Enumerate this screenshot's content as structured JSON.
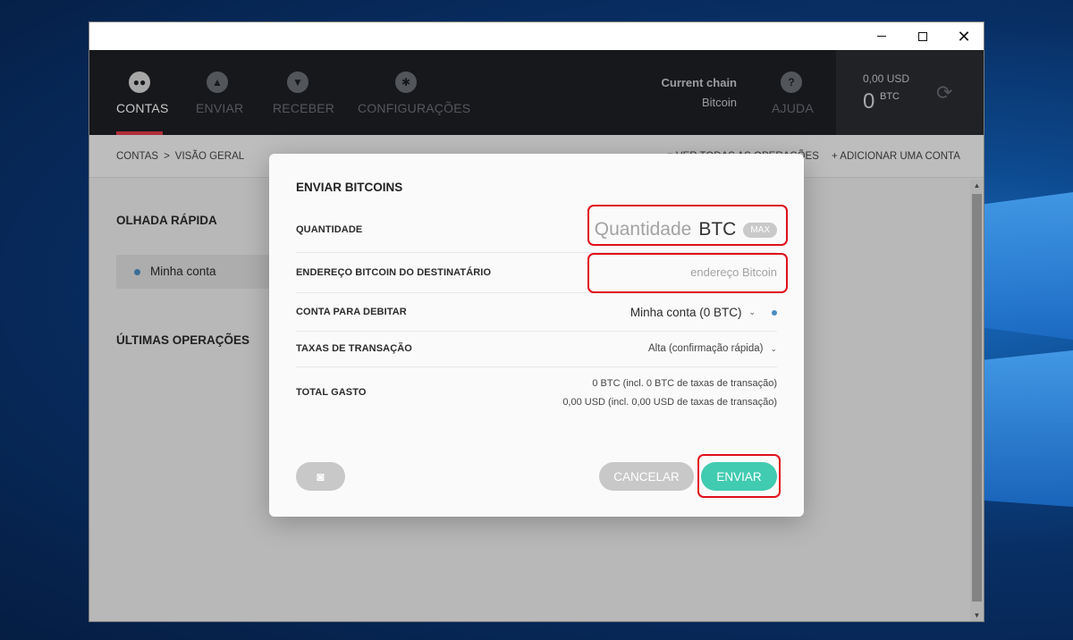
{
  "window": {
    "controls": {
      "minimize": "minimize",
      "maximize": "maximize",
      "close": "✕"
    }
  },
  "nav": {
    "items": [
      {
        "label": "CONTAS",
        "icon": "users-icon",
        "active": true
      },
      {
        "label": "ENVIAR",
        "icon": "arrow-up-icon",
        "active": false
      },
      {
        "label": "RECEBER",
        "icon": "arrow-down-icon",
        "active": false
      },
      {
        "label": "CONFIGURAÇÕES",
        "icon": "gear-icon",
        "active": false
      }
    ],
    "chain_title": "Current chain",
    "chain_value": "Bitcoin",
    "help_label": "AJUDA",
    "balance_usd": "0,00 USD",
    "balance_btc": "0",
    "balance_unit": "BTC",
    "accent_color": "#e33b4d"
  },
  "breadcrumb": {
    "root": "CONTAS",
    "separator": ">",
    "current": "VISÃO GERAL",
    "view_all": "VER TODAS AS OPERAÇÕES",
    "add_account": "ADICIONAR UMA CONTA"
  },
  "overview": {
    "quick_look_title": "OLHADA RÁPIDA",
    "account_name": "Minha conta",
    "last_ops_title": "ÚLTIMAS OPERAÇÕES"
  },
  "modal": {
    "title": "ENVIAR BITCOINS",
    "amount_label": "QUANTIDADE",
    "amount_placeholder": "Quantidade",
    "amount_unit": "BTC",
    "max_label": "MAX",
    "address_label": "ENDEREÇO BITCOIN DO DESTINATÁRIO",
    "address_placeholder": "endereço Bitcoin",
    "debit_label": "CONTA PARA DEBITAR",
    "debit_value": "Minha conta (0 BTC)",
    "fee_label": "TAXAS DE TRANSAÇÃO",
    "fee_value": "Alta (confirmação rápida)",
    "total_label": "TOTAL GASTO",
    "total_btc": "0 BTC (incl. 0 BTC de taxas de transação)",
    "total_usd": "0,00 USD (incl. 0,00 USD de taxas de transação)",
    "cancel_label": "CANCELAR",
    "send_label": "ENVIAR",
    "send_color": "#41cbb0"
  }
}
